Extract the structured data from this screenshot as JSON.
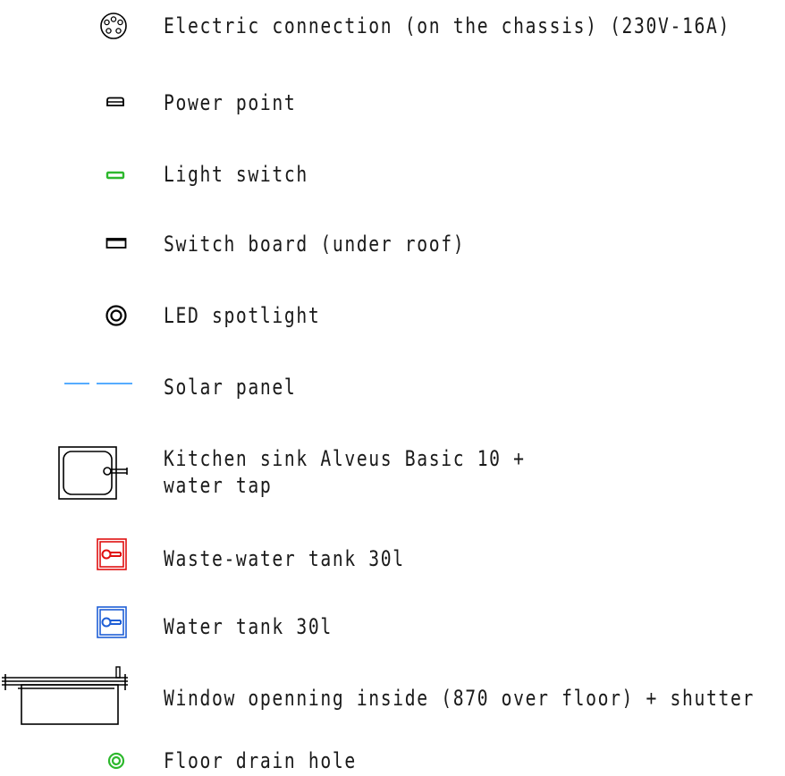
{
  "legend": {
    "electric_connection": "Electric connection (on the chassis) (230V-16A)",
    "power_point": "Power point",
    "light_switch": "Light switch",
    "switch_board": "Switch board (under roof)",
    "led_spotlight": "LED spotlight",
    "solar_panel": "Solar panel",
    "kitchen_sink_line1": "Kitchen sink Alveus Basic 10 +",
    "kitchen_sink_line2": "water tap",
    "waste_water_tank": "Waste-water tank 30l",
    "water_tank": "Water tank 30l",
    "window_opening": "Window openning inside (870 over floor) + shutter",
    "floor_drain": "Floor drain hole"
  },
  "colors": {
    "line": "#000000",
    "light_switch": "#2db82d",
    "solar_panel": "#1e90ff",
    "waste_water": "#e01010",
    "water": "#1f5fd6",
    "floor_drain": "#2db82d"
  }
}
